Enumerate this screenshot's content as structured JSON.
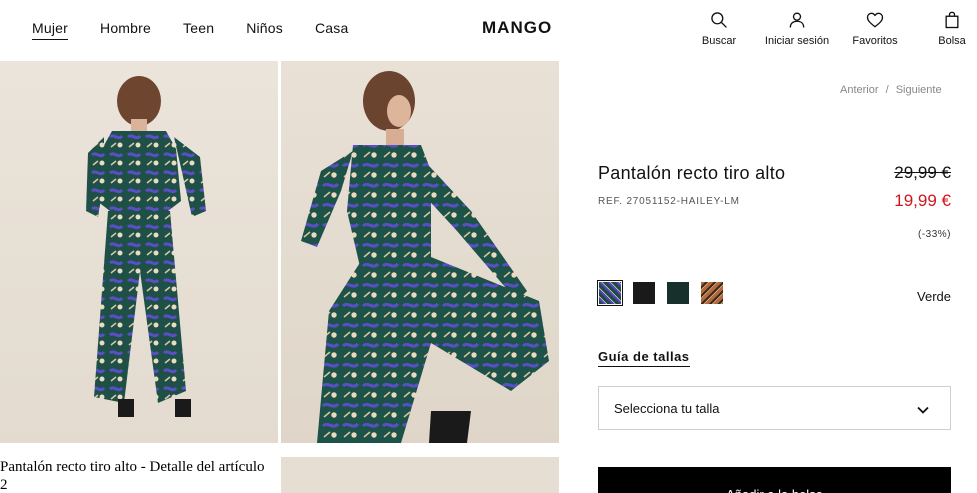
{
  "nav": {
    "items": [
      {
        "label": "Mujer",
        "active": true
      },
      {
        "label": "Hombre",
        "active": false
      },
      {
        "label": "Teen",
        "active": false
      },
      {
        "label": "Niños",
        "active": false
      },
      {
        "label": "Casa",
        "active": false
      }
    ]
  },
  "brand": "MANGO",
  "actions": {
    "search": {
      "label": "Buscar",
      "icon": "search-icon"
    },
    "login": {
      "label": "Iniciar sesión",
      "icon": "user-icon"
    },
    "favorites": {
      "label": "Favoritos",
      "icon": "heart-icon"
    },
    "bag": {
      "label": "Bolsa",
      "icon": "bag-icon"
    }
  },
  "gallery": {
    "caption": "Pantalón recto tiro alto - Detalle del artículo 2"
  },
  "pager": {
    "prev": "Anterior",
    "separator": "/",
    "next": "Siguiente"
  },
  "product": {
    "title": "Pantalón recto tiro alto",
    "ref": "REF. 27051152-HAILEY-LM",
    "old_price": "29,99 €",
    "new_price": "19,99 €",
    "discount": "(-33%)",
    "selected_color": "Verde",
    "swatches": [
      {
        "name": "print-green",
        "color": "#1d3b4a",
        "selected": true
      },
      {
        "name": "black",
        "color": "#1a1a1a",
        "selected": false
      },
      {
        "name": "dark-green",
        "color": "#17302c",
        "selected": false
      },
      {
        "name": "paisley-orange",
        "color": "#b5683a",
        "selected": false
      }
    ],
    "size_guide": "Guía de tallas",
    "size_placeholder": "Selecciona tu talla",
    "add_to_bag": "Añadir a la bolsa"
  },
  "colors": {
    "sale": "#d0161d",
    "button": "#000000"
  }
}
